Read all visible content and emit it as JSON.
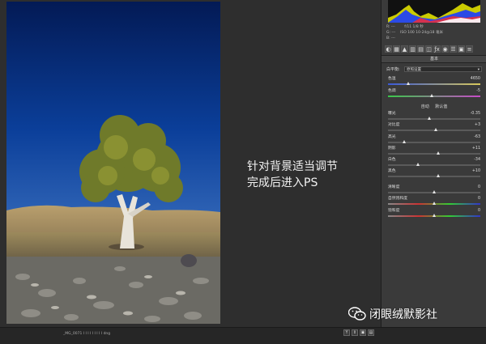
{
  "overlay": {
    "line1": "针对背景适当调节",
    "line2": "完成后进入PS"
  },
  "info": {
    "row1_left": "R: ---",
    "row1_right": "f/11  1/8 秒",
    "row2_left": "G: ---",
    "row2_right": "ISO 100   10-24@18 毫米",
    "row3_left": "B: ---"
  },
  "panel": {
    "section_title": "基本",
    "white_balance_label": "白平衡:",
    "white_balance_value": "原照设置",
    "auto_label": "自动",
    "default_label": "默认值",
    "sliders": [
      {
        "label": "色温",
        "value": "4650",
        "pos": 0.22
      },
      {
        "label": "色调",
        "value": "-5",
        "pos": 0.48
      },
      {
        "label": "曝光",
        "value": "-0.35",
        "pos": 0.45
      },
      {
        "label": "对比度",
        "value": "+3",
        "pos": 0.52
      },
      {
        "label": "高光",
        "value": "-63",
        "pos": 0.18
      },
      {
        "label": "阴影",
        "value": "+11",
        "pos": 0.55
      },
      {
        "label": "白色",
        "value": "-34",
        "pos": 0.33
      },
      {
        "label": "黑色",
        "value": "+10",
        "pos": 0.55
      },
      {
        "label": "清晰度",
        "value": "0",
        "pos": 0.5
      },
      {
        "label": "自然饱和度",
        "value": "0",
        "pos": 0.5
      },
      {
        "label": "饱和度",
        "value": "0",
        "pos": 0.5
      }
    ]
  },
  "bottom": {
    "filename": "_MG_0071 I I I I I I I I I   dng",
    "btn1": "Y",
    "btn2": "⇕",
    "btn3": "▣",
    "btn4": "▤"
  },
  "watermark": {
    "text": "闭眼绒默影社"
  }
}
